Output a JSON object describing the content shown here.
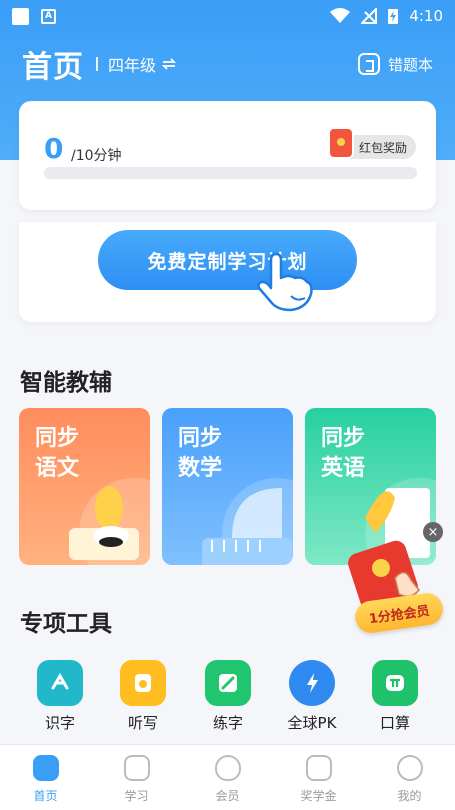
{
  "status_bar": {
    "time": "4:10"
  },
  "header": {
    "title": "首页",
    "grade": "四年级",
    "grade_switch_icon": "swap-arrows-icon",
    "wrong_book_label": "错题本"
  },
  "progress": {
    "value": "0",
    "unit": "/10分钟",
    "fraction": 0,
    "reward_label": "红包奖励"
  },
  "plan": {
    "button_label": "免费定制学习计划"
  },
  "smart_tutor": {
    "title": "智能教辅",
    "subjects": [
      {
        "line1": "同步",
        "line2": "语文"
      },
      {
        "line1": "同步",
        "line2": "数学"
      },
      {
        "line1": "同步",
        "line2": "英语"
      }
    ]
  },
  "promo": {
    "label": "1分抢会员",
    "close": "×"
  },
  "tools": {
    "title": "专项工具",
    "items": [
      {
        "label": "识字"
      },
      {
        "label": "听写"
      },
      {
        "label": "练字"
      },
      {
        "label": "全球PK"
      },
      {
        "label": "口算"
      }
    ]
  },
  "tabbar": {
    "items": [
      {
        "label": "首页",
        "active": true
      },
      {
        "label": "学习"
      },
      {
        "label": "会员"
      },
      {
        "label": "奖学金"
      },
      {
        "label": "我的"
      }
    ]
  },
  "colors": {
    "primary": "#3a9ef7",
    "chinese": "#ff8d5c",
    "math": "#4aa0fb",
    "english": "#27d0a0"
  }
}
